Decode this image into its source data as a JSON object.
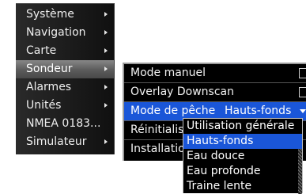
{
  "main_menu": {
    "items": [
      {
        "label": "Système",
        "submenu": true
      },
      {
        "label": "Navigation",
        "submenu": true
      },
      {
        "label": "Carte",
        "submenu": true
      },
      {
        "label": "Sondeur",
        "submenu": true,
        "selected": true
      },
      {
        "label": "Alarmes",
        "submenu": true
      },
      {
        "label": "Unités",
        "submenu": true
      },
      {
        "label": "NMEA 0183...",
        "submenu": false
      },
      {
        "label": "Simulateur",
        "submenu": true
      }
    ]
  },
  "sondeur_menu": {
    "items": [
      {
        "label": "Mode manuel",
        "checkbox": true,
        "checked": false
      },
      {
        "label": "Overlay Downscan",
        "checkbox": true,
        "checked": false
      },
      {
        "label": "Mode de pêche",
        "selected": true,
        "value": "Hauts-fonds"
      },
      {
        "label": "Réinitialise"
      },
      {
        "label": "Installation"
      }
    ]
  },
  "fishing_mode_dropdown": {
    "options": [
      "Utilisation générale",
      "Hauts-fonds",
      "Eau douce",
      "Eau profonde",
      "Traine lente"
    ],
    "selected": "Hauts-fonds"
  },
  "colors": {
    "highlight": "#1a56d8",
    "menu_bg": "#1e1e1e",
    "selected_gray": "#5e5e5e"
  }
}
